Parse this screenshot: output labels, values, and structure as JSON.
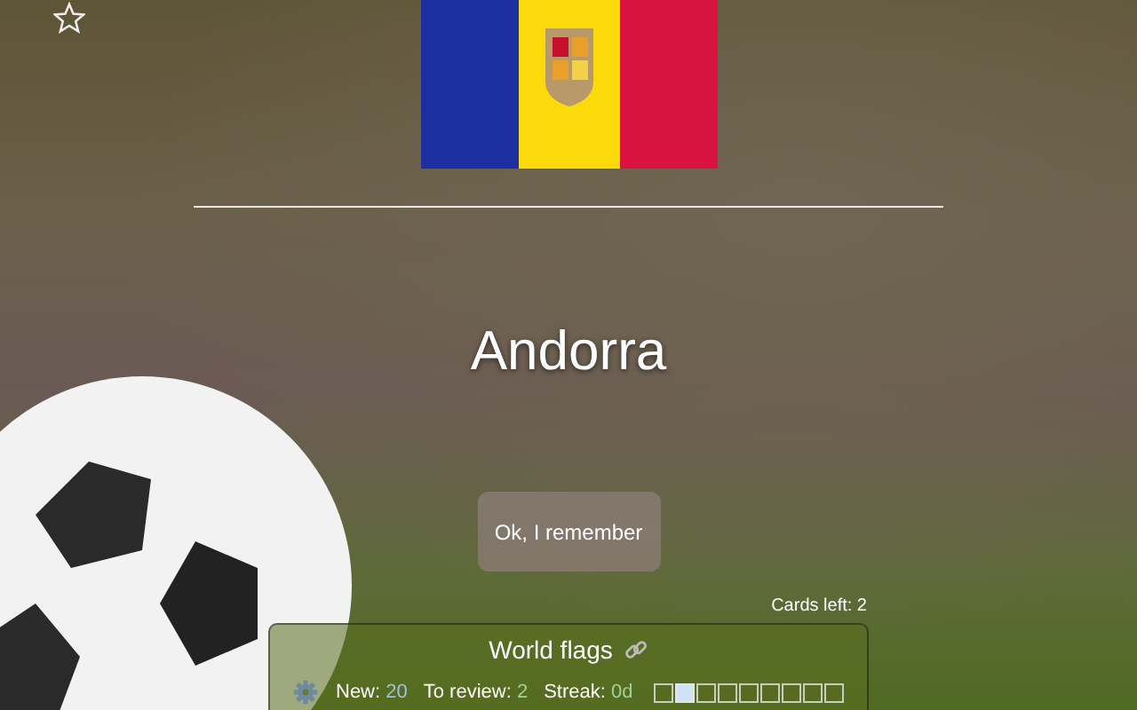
{
  "favorite": {
    "starred": false
  },
  "card": {
    "answer": "Andorra"
  },
  "buttons": [
    {
      "label": "Ok, I remember"
    }
  ],
  "cards_left": "Cards left: 2",
  "deck": {
    "title": "World flags",
    "stats": [
      {
        "label": "New:",
        "value": "20"
      },
      {
        "label": "To review:",
        "value": "2"
      },
      {
        "label": "Streak:",
        "value": "0d"
      }
    ],
    "streak_days": [
      {
        "filled": false
      },
      {
        "filled": true
      },
      {
        "filled": false
      },
      {
        "filled": false
      },
      {
        "filled": false
      },
      {
        "filled": false
      },
      {
        "filled": false
      },
      {
        "filled": false
      },
      {
        "filled": false
      }
    ]
  }
}
